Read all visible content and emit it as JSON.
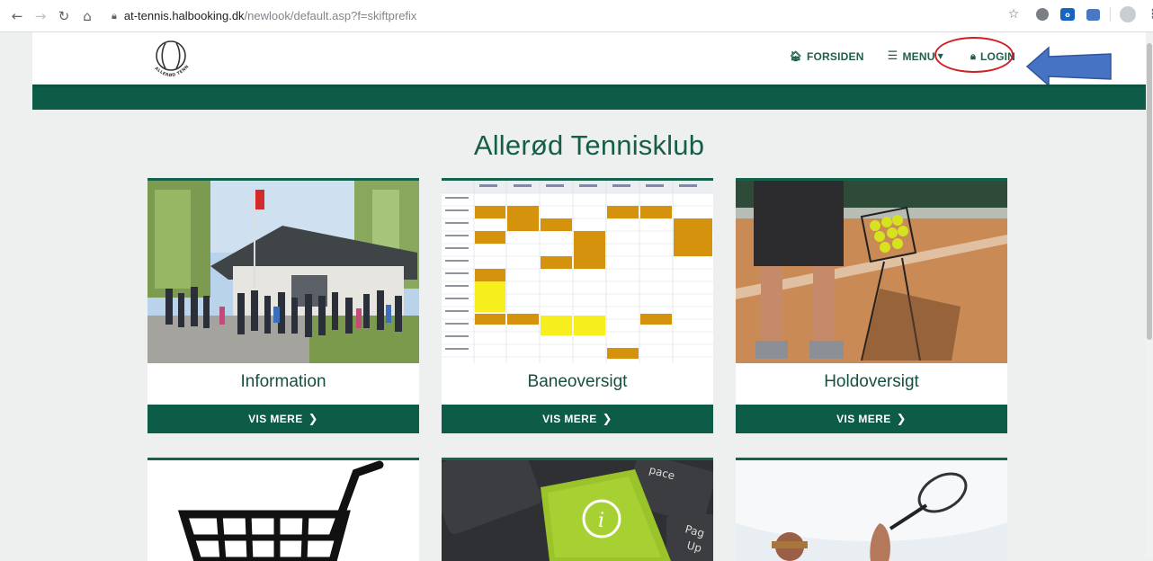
{
  "browser": {
    "url_host": "at-tennis.halbooking.dk",
    "url_path": "/newlook/default.asp?f=skiftprefix",
    "nav_icons": [
      "back-icon",
      "forward-icon",
      "reload-icon",
      "home-icon"
    ],
    "extensions": [
      "star-icon",
      "extension-icon",
      "outlook-icon",
      "chat-extension-icon",
      "profile-avatar-icon",
      "more-vert-icon"
    ]
  },
  "header": {
    "logo_text": "ALLERØD TENNISKLUB",
    "nav": [
      {
        "label": "FORSIDEN",
        "icon": "home-icon"
      },
      {
        "label": "MENU",
        "icon": "hamburger-icon"
      },
      {
        "label": "LOGIN",
        "icon": "lock-icon"
      }
    ]
  },
  "page": {
    "title": "Allerød Tennisklub"
  },
  "cards": [
    {
      "label": "Information",
      "button": "VIS MERE"
    },
    {
      "label": "Baneoversigt",
      "button": "VIS MERE"
    },
    {
      "label": "Holdoversigt",
      "button": "VIS MERE"
    }
  ],
  "colors": {
    "brand_green": "#0c5c48",
    "title_green": "#155e4a",
    "annotation_red": "#d11f25",
    "annotation_blue": "#3f6fbf"
  }
}
